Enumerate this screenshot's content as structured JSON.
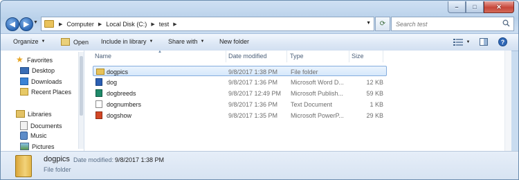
{
  "titlebar": {
    "minimize_glyph": "–",
    "maximize_glyph": "□",
    "close_glyph": "✕"
  },
  "address": {
    "breadcrumbs": [
      "Computer",
      "Local Disk (C:)",
      "test"
    ]
  },
  "search": {
    "placeholder": "Search test"
  },
  "toolbar": {
    "organize": "Organize",
    "open": "Open",
    "include_in_library": "Include in library",
    "share_with": "Share with",
    "new_folder": "New folder"
  },
  "navpane": {
    "favorites": "Favorites",
    "favorites_items": [
      "Desktop",
      "Downloads",
      "Recent Places"
    ],
    "libraries": "Libraries",
    "libraries_items": [
      "Documents",
      "Music",
      "Pictures"
    ]
  },
  "columns": {
    "name": "Name",
    "date_modified": "Date modified",
    "type": "Type",
    "size": "Size"
  },
  "files": [
    {
      "name": "dogpics",
      "date": "9/8/2017 1:38 PM",
      "type": "File folder",
      "size": "",
      "icon": "folder-icon"
    },
    {
      "name": "dog",
      "date": "9/8/2017 1:36 PM",
      "type": "Microsoft Word D...",
      "size": "12 KB",
      "icon": "word-document-icon"
    },
    {
      "name": "dogbreeds",
      "date": "9/8/2017 12:49 PM",
      "type": "Microsoft Publish...",
      "size": "59 KB",
      "icon": "publisher-document-icon"
    },
    {
      "name": "dognumbers",
      "date": "9/8/2017 1:36 PM",
      "type": "Text Document",
      "size": "1 KB",
      "icon": "text-document-icon"
    },
    {
      "name": "dogshow",
      "date": "9/8/2017 1:35 PM",
      "type": "Microsoft PowerP...",
      "size": "29 KB",
      "icon": "powerpoint-document-icon"
    }
  ],
  "details": {
    "name": "dogpics",
    "date_label": "Date modified:",
    "date_value": "9/8/2017 1:38 PM",
    "type": "File folder"
  },
  "colors": {
    "accent": "#2b67b5",
    "selection": "#d6e8fb",
    "close_button": "#c7473a"
  }
}
